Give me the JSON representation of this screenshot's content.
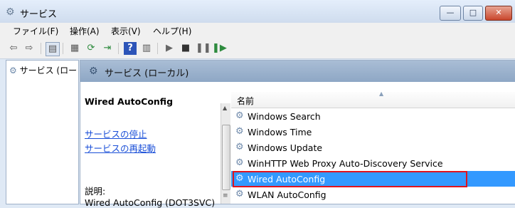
{
  "window": {
    "title": "サービス",
    "buttons": {
      "minimize": "—",
      "maximize": "□",
      "close": "✕"
    }
  },
  "menu": [
    "ファイル(F)",
    "操作(A)",
    "表示(V)",
    "ヘルプ(H)"
  ],
  "tree": {
    "item": "サービス (ロー"
  },
  "content": {
    "header": "サービス (ローカル)",
    "selected_title": "Wired AutoConfig",
    "links": [
      "サービスの停止",
      "サービスの再起動"
    ],
    "description_label": "説明:",
    "description_text": "Wired AutoConfig (DOT3SVC)"
  },
  "list": {
    "column_name": "名前",
    "rows": [
      {
        "label": "Windows Search",
        "selected": false
      },
      {
        "label": "Windows Time",
        "selected": false
      },
      {
        "label": "Windows Update",
        "selected": false
      },
      {
        "label": "WinHTTP Web Proxy Auto-Discovery Service",
        "selected": false
      },
      {
        "label": "Wired AutoConfig",
        "selected": true
      },
      {
        "label": "WLAN AutoConfig",
        "selected": false
      }
    ]
  },
  "colors": {
    "selection": "#3399ff",
    "highlight_border": "#e0141e",
    "link": "#1a4fd8",
    "header_bg": "#a9bdd5"
  },
  "icons": {
    "app": "gear-icon",
    "service": "gear-icon"
  }
}
